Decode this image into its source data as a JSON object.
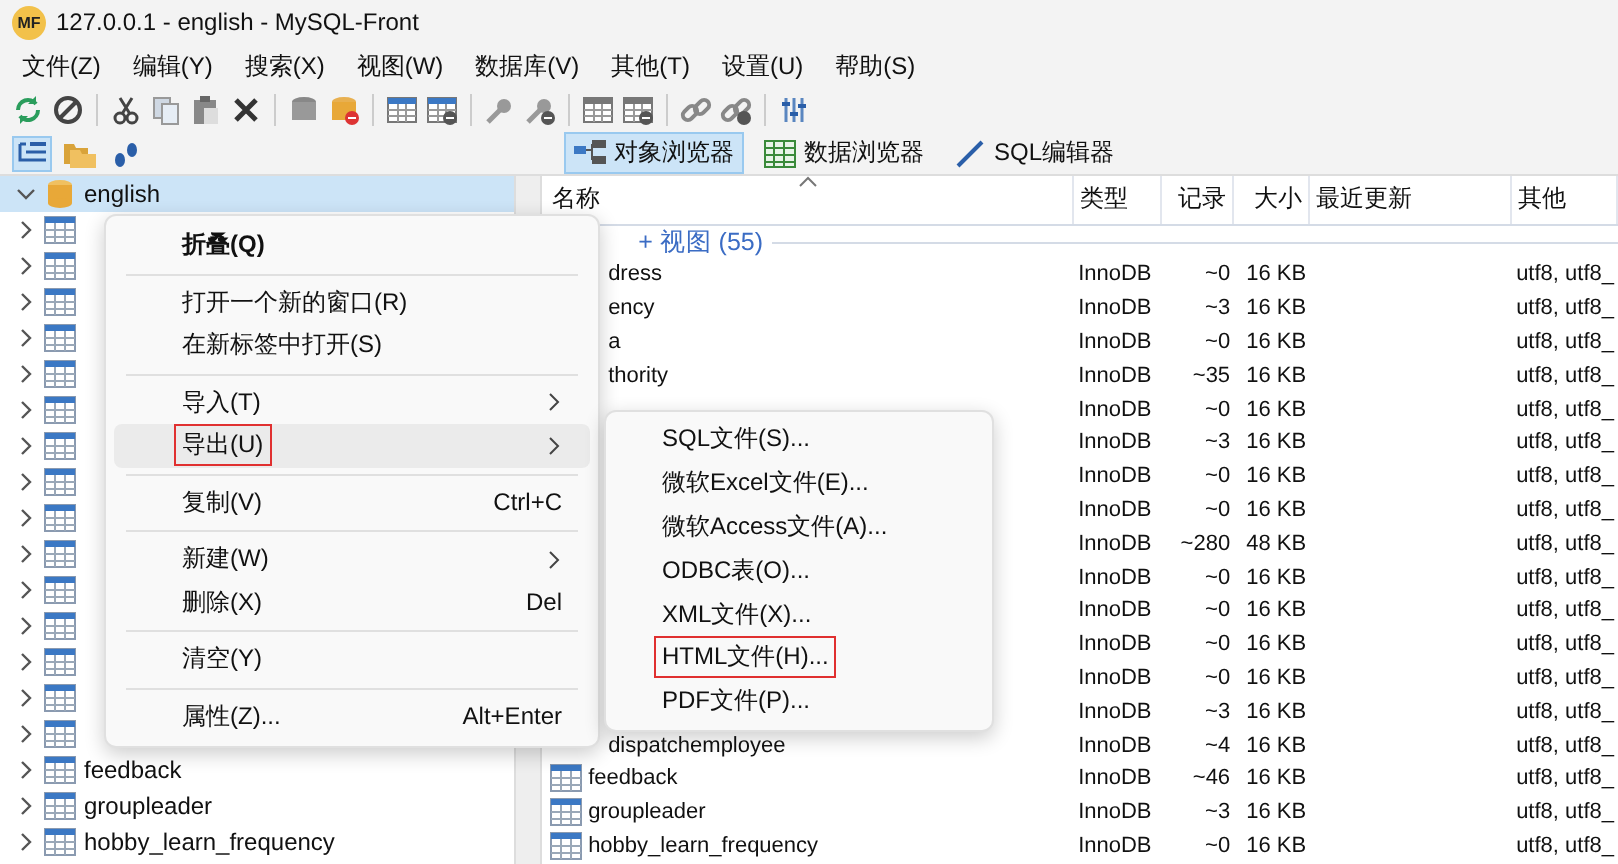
{
  "window": {
    "logo": "MF",
    "title": "127.0.0.1 - english - MySQL-Front"
  },
  "menu_bar": [
    "文件(Z)",
    "编辑(Y)",
    "搜索(X)",
    "视图(W)",
    "数据库(V)",
    "其他(T)",
    "设置(U)",
    "帮助(S)"
  ],
  "view_tabs": [
    {
      "label": "对象浏览器",
      "kind": "object",
      "selected": true
    },
    {
      "label": "数据浏览器",
      "kind": "data",
      "selected": false
    },
    {
      "label": "SQL编辑器",
      "kind": "sql",
      "selected": false
    }
  ],
  "tree": {
    "root": {
      "label": "english",
      "selected": true
    },
    "children": [
      {
        "kind": "table"
      },
      {
        "kind": "table"
      },
      {
        "kind": "table"
      },
      {
        "kind": "table"
      },
      {
        "kind": "table"
      },
      {
        "kind": "table"
      },
      {
        "kind": "table"
      },
      {
        "kind": "table"
      },
      {
        "kind": "table"
      },
      {
        "kind": "table"
      },
      {
        "kind": "table"
      },
      {
        "kind": "table"
      },
      {
        "kind": "table"
      },
      {
        "kind": "table"
      },
      {
        "kind": "table"
      },
      {
        "kind": "table",
        "label": "feedback"
      },
      {
        "kind": "table",
        "label": "groupleader"
      },
      {
        "kind": "table",
        "label": "hobby_learn_frequency"
      }
    ]
  },
  "list": {
    "columns": [
      "名称",
      "类型",
      "记录",
      "大小",
      "最近更新",
      "其他"
    ],
    "group": "+ 视图 (55)",
    "rows": [
      {
        "kind": "covered",
        "name": "dress",
        "type": "InnoDB",
        "records": "~0",
        "size": "16 KB",
        "other": "utf8, utf8_"
      },
      {
        "kind": "covered",
        "name": "ency",
        "type": "InnoDB",
        "records": "~3",
        "size": "16 KB",
        "other": "utf8, utf8_"
      },
      {
        "kind": "covered",
        "name": "a",
        "type": "InnoDB",
        "records": "~0",
        "size": "16 KB",
        "other": "utf8, utf8_"
      },
      {
        "kind": "covered",
        "name": "thority",
        "type": "InnoDB",
        "records": "~35",
        "size": "16 KB",
        "other": "utf8, utf8_"
      },
      {
        "kind": "covered",
        "type": "InnoDB",
        "records": "~0",
        "size": "16 KB",
        "other": "utf8, utf8_"
      },
      {
        "kind": "covered",
        "type": "InnoDB",
        "records": "~3",
        "size": "16 KB",
        "other": "utf8, utf8_"
      },
      {
        "kind": "covered",
        "type": "InnoDB",
        "records": "~0",
        "size": "16 KB",
        "other": "utf8, utf8_"
      },
      {
        "kind": "covered",
        "type": "InnoDB",
        "records": "~0",
        "size": "16 KB",
        "other": "utf8, utf8_"
      },
      {
        "kind": "covered",
        "type": "InnoDB",
        "records": "~280",
        "size": "48 KB",
        "other": "utf8, utf8_"
      },
      {
        "kind": "covered",
        "type": "InnoDB",
        "records": "~0",
        "size": "16 KB",
        "other": "utf8, utf8_"
      },
      {
        "kind": "covered",
        "type": "InnoDB",
        "records": "~0",
        "size": "16 KB",
        "other": "utf8, utf8_"
      },
      {
        "kind": "covered",
        "type": "InnoDB",
        "records": "~0",
        "size": "16 KB",
        "other": "utf8, utf8_"
      },
      {
        "kind": "covered",
        "type": "InnoDB",
        "records": "~0",
        "size": "16 KB",
        "other": "utf8, utf8_"
      },
      {
        "kind": "covered",
        "type": "InnoDB",
        "records": "~3",
        "size": "16 KB",
        "other": "utf8, utf8_"
      },
      {
        "kind": "covered",
        "name": "dispatchemployee",
        "type": "InnoDB",
        "records": "~4",
        "size": "16 KB",
        "other": "utf8, utf8_"
      },
      {
        "kind": "table",
        "name": "feedback",
        "type": "InnoDB",
        "records": "~46",
        "size": "16 KB",
        "other": "utf8, utf8_"
      },
      {
        "kind": "table",
        "name": "groupleader",
        "type": "InnoDB",
        "records": "~3",
        "size": "16 KB",
        "other": "utf8, utf8_"
      },
      {
        "kind": "table",
        "name": "hobby_learn_frequency",
        "type": "InnoDB",
        "records": "~0",
        "size": "16 KB",
        "other": "utf8, utf8_"
      }
    ]
  },
  "context_menu": [
    {
      "kind": "item",
      "label": "折叠(Q)",
      "bold": true
    },
    {
      "kind": "separator"
    },
    {
      "kind": "item",
      "label": "打开一个新的窗口(R)",
      "bold": false
    },
    {
      "kind": "item",
      "label": "在新标签中打开(S)",
      "bold": false
    },
    {
      "kind": "separator"
    },
    {
      "kind": "submenu",
      "label": "导入(T)",
      "selected": false,
      "highlighted": false
    },
    {
      "kind": "submenu",
      "label": "导出(U)",
      "selected": true,
      "highlighted": true
    },
    {
      "kind": "separator"
    },
    {
      "kind": "item",
      "label": "复制(V)",
      "shortcut": "Ctrl+C",
      "bold": false
    },
    {
      "kind": "separator"
    },
    {
      "kind": "submenu",
      "label": "新建(W)",
      "selected": false,
      "highlighted": false
    },
    {
      "kind": "item",
      "label": "删除(X)",
      "shortcut": "Del",
      "bold": false
    },
    {
      "kind": "separator"
    },
    {
      "kind": "item",
      "label": "清空(Y)",
      "bold": false
    },
    {
      "kind": "separator"
    },
    {
      "kind": "item",
      "label": "属性(Z)...",
      "shortcut": "Alt+Enter",
      "bold": false
    }
  ],
  "export_submenu": [
    {
      "label": "SQL文件(S)...",
      "highlighted": false
    },
    {
      "label": "微软Excel文件(E)...",
      "highlighted": false
    },
    {
      "label": "微软Access文件(A)...",
      "highlighted": false
    },
    {
      "label": "ODBC表(O)...",
      "highlighted": false
    },
    {
      "label": "XML文件(X)...",
      "highlighted": false
    },
    {
      "label": "HTML文件(H)...",
      "highlighted": true
    },
    {
      "label": "PDF文件(P)...",
      "highlighted": false
    }
  ]
}
